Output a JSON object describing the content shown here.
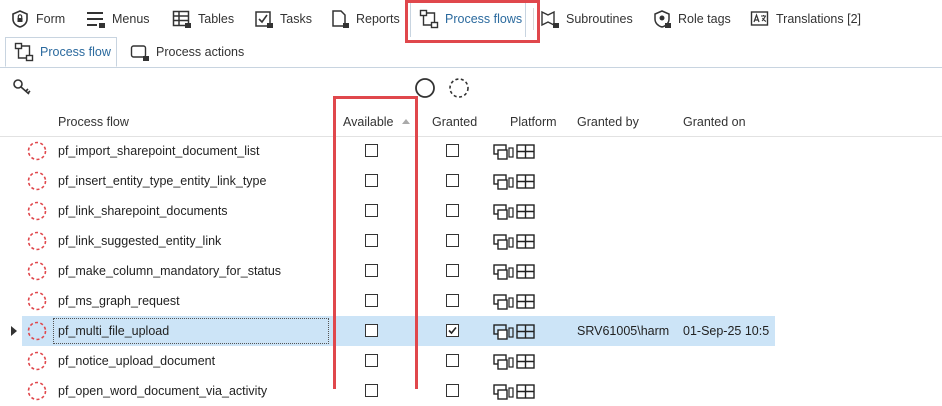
{
  "top_tabs": [
    {
      "label": "Form",
      "icon": "shield-lock-icon"
    },
    {
      "label": "Menus",
      "icon": "menu-lock-icon"
    },
    {
      "label": "Tables",
      "icon": "table-lock-icon"
    },
    {
      "label": "Tasks",
      "icon": "task-lock-icon"
    },
    {
      "label": "Reports",
      "icon": "report-lock-icon"
    },
    {
      "label": "Process flows",
      "icon": "process-flow-icon"
    },
    {
      "label": "Subroutines",
      "icon": "subroutine-lock-icon"
    },
    {
      "label": "Role tags",
      "icon": "role-tag-icon"
    },
    {
      "label": "Translations [2]",
      "icon": "translation-icon"
    }
  ],
  "sub_tabs": [
    {
      "label": "Process flow",
      "icon": "process-flow-icon"
    },
    {
      "label": "Process actions",
      "icon": "process-action-lock-icon"
    }
  ],
  "toolbar": {
    "icons": [
      "key-icon",
      "circle-solid-icon",
      "circle-dashed-icon"
    ]
  },
  "grid": {
    "columns": {
      "name": "Process flow",
      "available": "Available",
      "granted": "Granted",
      "platform": "Platform",
      "granted_by": "Granted by",
      "granted_on": "Granted on"
    },
    "rows": [
      {
        "name": "pf_import_sharepoint_document_list",
        "available": false,
        "granted": false,
        "granted_by": "",
        "granted_on": ""
      },
      {
        "name": "pf_insert_entity_type_entity_link_type",
        "available": false,
        "granted": false,
        "granted_by": "",
        "granted_on": ""
      },
      {
        "name": "pf_link_sharepoint_documents",
        "available": false,
        "granted": false,
        "granted_by": "",
        "granted_on": ""
      },
      {
        "name": "pf_link_suggested_entity_link",
        "available": false,
        "granted": false,
        "granted_by": "",
        "granted_on": ""
      },
      {
        "name": "pf_make_column_mandatory_for_status",
        "available": false,
        "granted": false,
        "granted_by": "",
        "granted_on": ""
      },
      {
        "name": "pf_ms_graph_request",
        "available": false,
        "granted": false,
        "granted_by": "",
        "granted_on": ""
      },
      {
        "name": "pf_multi_file_upload",
        "available": false,
        "granted": true,
        "granted_by": "SRV61005\\harm",
        "granted_on": "01-Sep-25 10:5",
        "selected": true
      },
      {
        "name": "pf_notice_upload_document",
        "available": false,
        "granted": false,
        "granted_by": "",
        "granted_on": ""
      },
      {
        "name": "pf_open_word_document_via_activity",
        "available": false,
        "granted": false,
        "granted_by": "",
        "granted_on": ""
      }
    ]
  },
  "colors": {
    "accent": "#2b6a9e",
    "selection": "#cce4f7",
    "annotation": "#e0474c",
    "status_dashed": "#e0474c"
  }
}
